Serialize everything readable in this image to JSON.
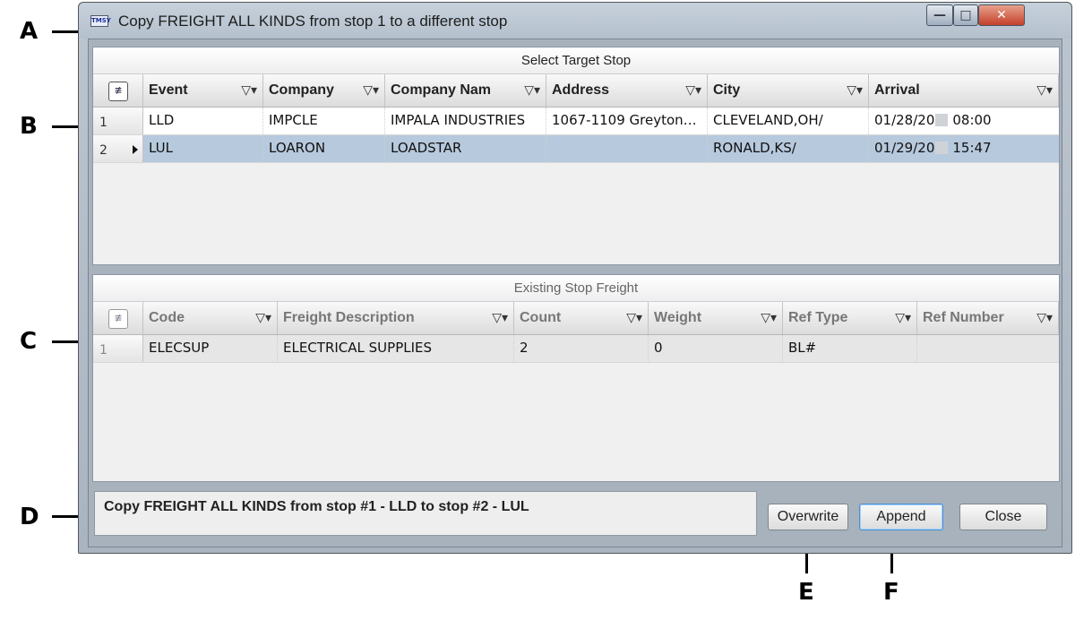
{
  "callouts": [
    "A",
    "B",
    "C",
    "D",
    "E",
    "F"
  ],
  "window": {
    "icon_text": "TMSY",
    "title": "Copy FREIGHT ALL KINDS from stop 1 to a different stop",
    "minimize": "—",
    "maximize": "□",
    "close": "✕"
  },
  "target_grid": {
    "title": "Select Target Stop",
    "selector_icon": "≢",
    "filter_glyph": "▽▾",
    "columns": [
      "Event",
      "Company",
      "Company Nam",
      "Address",
      "City",
      "Arrival"
    ],
    "rows": [
      {
        "num": "1",
        "event": "LLD",
        "company": "IMPCLE",
        "company_name": "IMPALA INDUSTRIES",
        "address": "1067-1109 Greyton…",
        "city": "CLEVELAND,OH/",
        "arrival_date": "01/28/20",
        "arrival_time": "08:00"
      },
      {
        "num": "2",
        "event": "LUL",
        "company": "LOARON",
        "company_name": "LOADSTAR",
        "address": "",
        "city": "RONALD,KS/",
        "arrival_date": "01/29/20",
        "arrival_time": "15:47"
      }
    ]
  },
  "freight_grid": {
    "title": "Existing Stop Freight",
    "selector_icon": "≢",
    "filter_glyph": "▽▾",
    "columns": [
      "Code",
      "Freight Description",
      "Count",
      "Weight",
      "Ref Type",
      "Ref Number"
    ],
    "rows": [
      {
        "num": "1",
        "code": "ELECSUP",
        "description": "ELECTRICAL SUPPLIES",
        "count": "2",
        "weight": "0",
        "ref_type": "BL#",
        "ref_number": ""
      }
    ]
  },
  "message": "Copy FREIGHT ALL KINDS from stop #1 - LLD to stop #2 - LUL",
  "buttons": {
    "overwrite": "Overwrite",
    "append": "Append",
    "close": "Close"
  },
  "icons": {
    "app": "tmsy-app-icon",
    "filter": "funnel-icon",
    "selector": "column-chooser-icon",
    "row_indicator": "row-pointer-icon"
  }
}
